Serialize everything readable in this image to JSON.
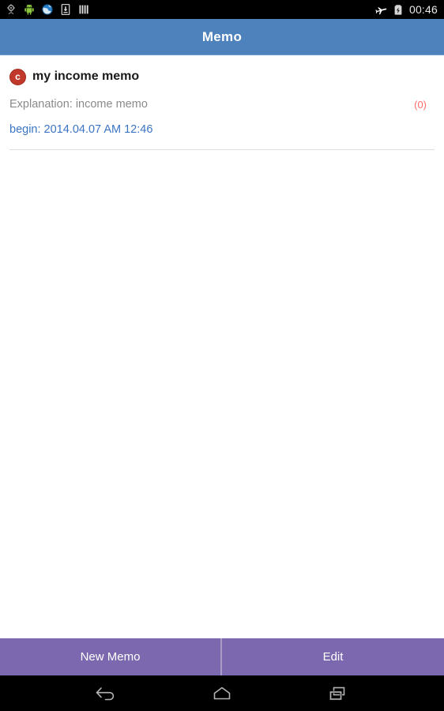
{
  "statusbar": {
    "time": "00:46",
    "left_icons": [
      {
        "name": "location-icon"
      },
      {
        "name": "android-icon"
      },
      {
        "name": "browser-globe-icon"
      },
      {
        "name": "download-icon"
      },
      {
        "name": "signal-bars-icon"
      }
    ],
    "right_icons": [
      {
        "name": "airplane-mode-icon"
      },
      {
        "name": "battery-charging-icon"
      }
    ]
  },
  "appbar": {
    "title": "Memo"
  },
  "memo": {
    "badge_letter": "c",
    "title": "my income memo",
    "description": "Explanation: income memo",
    "count": "(0)",
    "begin": "begin: 2014.04.07 AM 12:46"
  },
  "buttons": {
    "new_memo": "New Memo",
    "edit": "Edit"
  },
  "navbar": {
    "back": "back-icon",
    "home": "home-icon",
    "recents": "recents-icon"
  },
  "colors": {
    "appbar": "#4e82bd",
    "button_bar": "#7b68ae",
    "badge": "#c0392b",
    "link": "#3b74c4",
    "count": "#ff6b6b"
  }
}
